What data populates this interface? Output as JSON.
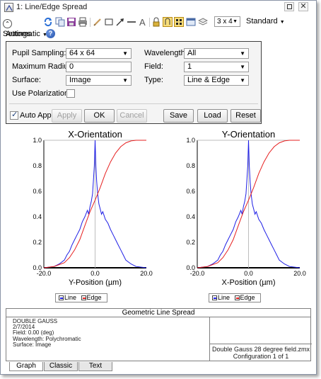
{
  "window": {
    "title": "1: Line/Edge Spread"
  },
  "toolbar": {
    "settings_label": "Settings",
    "layout_value": "3 x 4",
    "standard_label": "Standard",
    "automatic_label": "Automatic",
    "icons": [
      "refresh-icon",
      "copy-icon",
      "save-icon",
      "print-icon",
      "pencil-icon",
      "rectangle-icon",
      "arrow-icon",
      "line-icon",
      "text-icon",
      "lock-icon",
      "hold-icon",
      "grid-icon",
      "window-icon",
      "layers-icon",
      "help-icon"
    ]
  },
  "settings": {
    "pupil_sampling_label": "Pupil Sampling:",
    "pupil_sampling_value": "64 x 64",
    "max_radius_label": "Maximum Radius:",
    "max_radius_value": "0",
    "surface_label": "Surface:",
    "surface_value": "Image",
    "use_polarization_label": "Use Polarization:",
    "wavelength_label": "Wavelength:",
    "wavelength_value": "All",
    "field_label": "Field:",
    "field_value": "1",
    "type_label": "Type:",
    "type_value": "Line & Edge",
    "auto_apply_label": "Auto Apply",
    "apply_label": "Apply",
    "ok_label": "OK",
    "cancel_label": "Cancel",
    "save_label": "Save",
    "load_label": "Load",
    "reset_label": "Reset"
  },
  "colors": {
    "line": "#1f1fe6",
    "edge": "#e61f1f"
  },
  "chart_data": [
    {
      "type": "line",
      "title": "X-Orientation",
      "xlabel": "Y-Position (µm)",
      "xlim": [
        -20.0,
        20.0
      ],
      "ylim": [
        0.0,
        1.0
      ],
      "x_ticks": [
        "-20.0",
        "0.0",
        "20.0"
      ],
      "y_ticks": [
        "0.0",
        "0.2",
        "0.4",
        "0.6",
        "0.8",
        "1.0"
      ],
      "legend": [
        "Line",
        "Edge"
      ],
      "series": [
        {
          "name": "Line",
          "x": [
            -20,
            -16,
            -14,
            -12,
            -11,
            -10,
            -9,
            -8,
            -7,
            -6,
            -5,
            -4,
            -3,
            -2.5,
            -2,
            -1.5,
            -1,
            -0.6,
            -0.3,
            0,
            0.3,
            0.6,
            1,
            1.5,
            2,
            2.5,
            3,
            4,
            5,
            6,
            7,
            8,
            9,
            10,
            11,
            12,
            14,
            16,
            20
          ],
          "y": [
            0.0,
            0.01,
            0.03,
            0.06,
            0.1,
            0.13,
            0.18,
            0.22,
            0.26,
            0.3,
            0.36,
            0.4,
            0.45,
            0.42,
            0.48,
            0.52,
            0.58,
            0.7,
            0.8,
            1.0,
            0.8,
            0.68,
            0.58,
            0.5,
            0.46,
            0.42,
            0.44,
            0.38,
            0.35,
            0.3,
            0.26,
            0.22,
            0.18,
            0.14,
            0.1,
            0.06,
            0.03,
            0.01,
            0.0
          ]
        },
        {
          "name": "Edge",
          "x": [
            -20,
            -16,
            -12,
            -10,
            -8,
            -6,
            -4,
            -2,
            0,
            2,
            4,
            6,
            8,
            10,
            12,
            14,
            16,
            20
          ],
          "y": [
            0.0,
            0.01,
            0.04,
            0.08,
            0.14,
            0.22,
            0.33,
            0.44,
            0.53,
            0.63,
            0.74,
            0.83,
            0.9,
            0.95,
            0.98,
            0.995,
            1.0,
            1.0
          ]
        }
      ]
    },
    {
      "type": "line",
      "title": "Y-Orientation",
      "xlabel": "X-Position (µm)",
      "xlim": [
        -20.0,
        20.0
      ],
      "ylim": [
        0.0,
        1.0
      ],
      "x_ticks": [
        "-20.0",
        "0.0",
        "20.0"
      ],
      "y_ticks": [
        "0.0",
        "0.2",
        "0.4",
        "0.6",
        "0.8",
        "1.0"
      ],
      "legend": [
        "Line",
        "Edge"
      ],
      "series": [
        {
          "name": "Line",
          "x": [
            -20,
            -16,
            -14,
            -12,
            -11,
            -10,
            -9,
            -8,
            -7,
            -6,
            -5,
            -4,
            -3,
            -2.5,
            -2,
            -1.5,
            -1,
            -0.6,
            -0.3,
            0,
            0.3,
            0.6,
            1,
            1.5,
            2,
            2.5,
            3,
            4,
            5,
            6,
            7,
            8,
            9,
            10,
            11,
            12,
            14,
            16,
            20
          ],
          "y": [
            0.0,
            0.01,
            0.03,
            0.06,
            0.1,
            0.13,
            0.18,
            0.22,
            0.26,
            0.3,
            0.36,
            0.4,
            0.45,
            0.42,
            0.48,
            0.52,
            0.58,
            0.7,
            0.8,
            1.0,
            0.8,
            0.68,
            0.58,
            0.5,
            0.46,
            0.42,
            0.44,
            0.38,
            0.35,
            0.3,
            0.26,
            0.22,
            0.18,
            0.14,
            0.1,
            0.06,
            0.03,
            0.01,
            0.0
          ]
        },
        {
          "name": "Edge",
          "x": [
            -20,
            -16,
            -12,
            -10,
            -8,
            -6,
            -4,
            -2,
            0,
            2,
            4,
            6,
            8,
            10,
            12,
            14,
            16,
            20
          ],
          "y": [
            0.0,
            0.01,
            0.04,
            0.08,
            0.14,
            0.22,
            0.33,
            0.44,
            0.53,
            0.63,
            0.74,
            0.83,
            0.9,
            0.95,
            0.98,
            0.995,
            1.0,
            1.0
          ]
        }
      ]
    }
  ],
  "info": {
    "title": "Geometric Line Spread",
    "lens_name": "DOUBLE GAUSS",
    "date": "2/7/2014",
    "field": "Field: 0.00 (deg)",
    "wavelength": "Wavelength: Polychromatic",
    "surface": "Surface: Image",
    "file_name": "Double Gauss 28 degree field.zmx",
    "configuration": "Configuration 1 of 1"
  },
  "tabs": [
    "Graph",
    "Classic",
    "Text"
  ]
}
